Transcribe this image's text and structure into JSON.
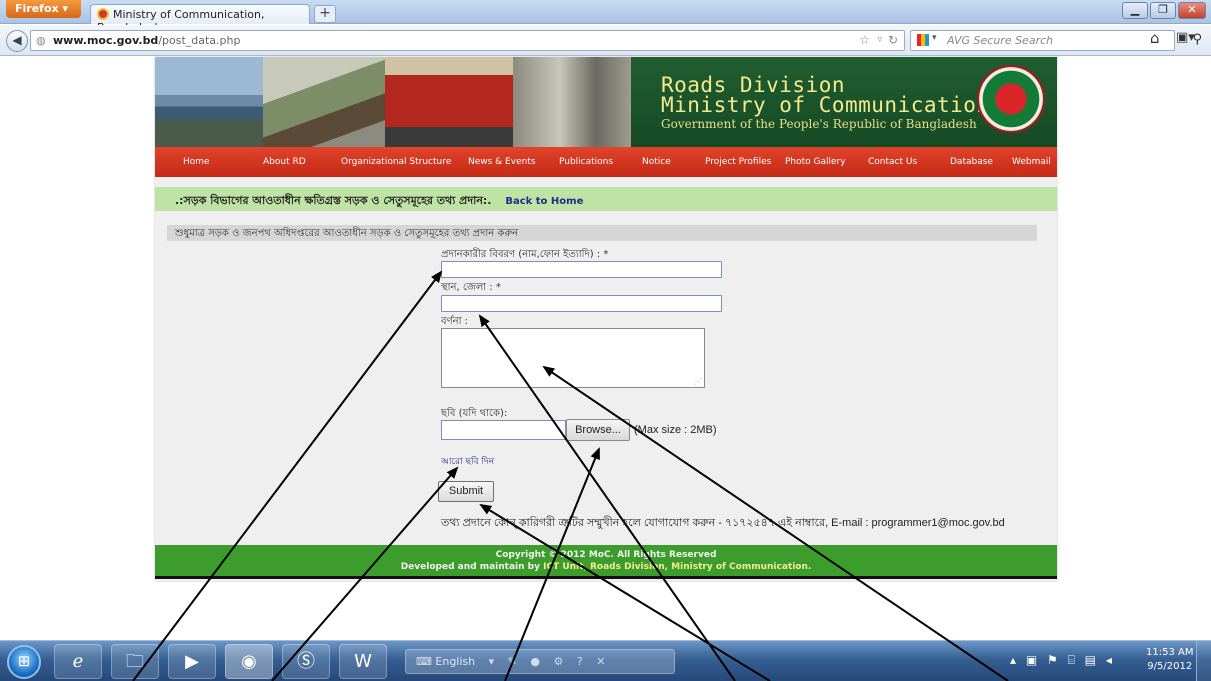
{
  "browser": {
    "menu_label": "Firefox",
    "tab_title": "Ministry of Communication, Bangladesh",
    "newtab_label": "+",
    "url_domain": "www.moc.gov.bd",
    "url_path": "/post_data.php",
    "search_placeholder": "AVG Secure Search",
    "window_controls": [
      "minimize-icon",
      "restore-icon",
      "close-icon"
    ]
  },
  "site": {
    "banner": {
      "title_line1": "Roads Division",
      "title_line2": "Ministry of Communication",
      "subtitle": "Government of the People's Republic of Bangladesh"
    },
    "menu": [
      "Home",
      "About RD",
      "Organizational Structure",
      "News & Events",
      "Publications",
      "Notice",
      "Project Profiles",
      "Photo Gallery",
      "Contact Us",
      "Database",
      "Webmail"
    ],
    "header_text": ".:সড়ক বিভাগের আওতাধীন ক্ষতিগ্রস্ত সড়ক ও সেতুসমূহের তথ্য প্রদান:.",
    "back_home": "Back to Home",
    "subheader": "শুধুমাত্র সড়ক ও জনপথ অধিদপ্তরের আওতাধীন সড়ক ও সেতুসমূহের তথ্য প্রদান করুন",
    "form": {
      "provider_label": "প্রদানকারীর বিবরণ (নাম,ফোন ইত্যাদি) : *",
      "location_label": "স্থান, জেলা : *",
      "description_label": "বর্ণনা :",
      "photo_label": "ছবি (যদি থাকে):",
      "browse_label": "Browse...",
      "max_size": "(Max size : 2MB)",
      "more_photo": "আরো ছবি দিন",
      "submit_label": "Submit",
      "contact_note": "তথ্য প্রদানে কোন্‌ কারিগরী ত্রুটির সম্মুখীন হলে যোগাযোগ করুন - ৭১৭২৫৪৭ এই নাম্বারে, E-mail : programmer1@moc.gov.bd"
    },
    "footer": {
      "copyright": "Copyright © 2012 MoC. All Rights Reserved",
      "credit_prefix": "Developed and maintain by",
      "credit_link": "ICT Unit, Roads Division, Ministry of Communication."
    }
  },
  "taskbar": {
    "language": "English",
    "clock_time": "11:53 AM",
    "clock_date": "9/5/2012"
  }
}
